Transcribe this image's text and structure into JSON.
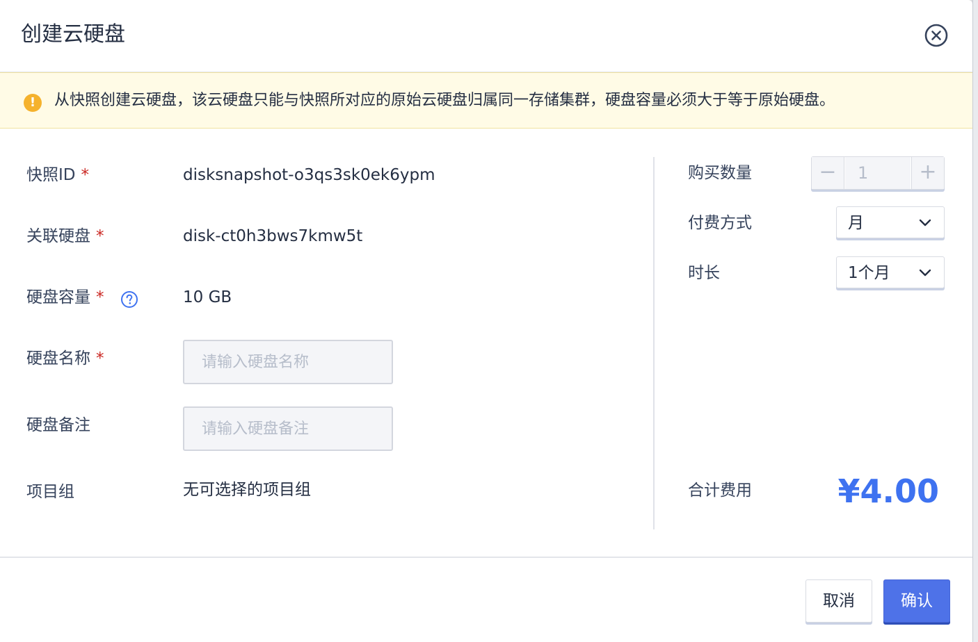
{
  "dialog": {
    "title": "创建云硬盘"
  },
  "alert": {
    "text": "从快照创建云硬盘，该云硬盘只能与快照所对应的原始云硬盘归属同一存储集群，硬盘容量必须大于等于原始硬盘。"
  },
  "form": {
    "snapshot_id": {
      "label": "快照ID",
      "required": "*",
      "value": "disksnapshot-o3qs3sk0ek6ypm"
    },
    "related_disk": {
      "label": "关联硬盘",
      "required": "*",
      "value": "disk-ct0h3bws7kmw5t"
    },
    "disk_capacity": {
      "label": "硬盘容量",
      "required": "*",
      "value": "10 GB"
    },
    "disk_name": {
      "label": "硬盘名称",
      "required": "*",
      "placeholder": "请输入硬盘名称"
    },
    "disk_note": {
      "label": "硬盘备注",
      "placeholder": "请输入硬盘备注"
    },
    "project_group": {
      "label": "项目组",
      "value": "无可选择的项目组"
    }
  },
  "purchase": {
    "quantity": {
      "label": "购买数量",
      "value": "1",
      "minus": "−",
      "plus": "+"
    },
    "payment": {
      "label": "付费方式",
      "value": "月"
    },
    "duration": {
      "label": "时长",
      "value": "1个月"
    },
    "total": {
      "label": "合计费用",
      "price": "¥4.00"
    }
  },
  "buttons": {
    "cancel": "取消",
    "confirm": "确认"
  },
  "colors": {
    "accent": "#3e72f0",
    "primary_button": "#4e72e8",
    "required": "#ca2621",
    "warning": "#f5b22d",
    "alert_bg": "#fffbe6"
  },
  "icons": {
    "close": "close-circle-icon",
    "alert": "exclamation-circle-icon",
    "help": "question-circle-icon",
    "dropdown": "chevron-down-icon"
  }
}
